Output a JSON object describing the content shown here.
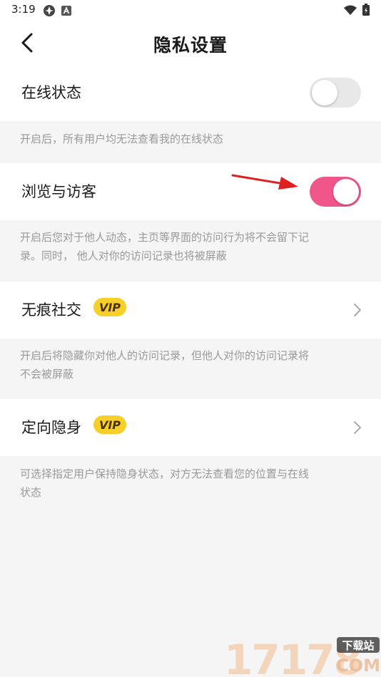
{
  "status_bar": {
    "time": "3:19"
  },
  "header": {
    "title": "隐私设置"
  },
  "settings": {
    "online_status": {
      "label": "在线状态",
      "enabled": false,
      "description": "开启后，所有用户均无法查看我的在线状态"
    },
    "browse_visitors": {
      "label": "浏览与访客",
      "enabled": true,
      "description_line1": "开启后您对于他人动态，主页等界面的访问行为将不会留下记",
      "description_line2": "录。同时， 他人对你的访问记录也将被屏蔽"
    },
    "traceless_social": {
      "label": "无痕社交",
      "badge": "VIP",
      "description_line1": "开启后将隐藏你对他人的访问记录，但他人对你的访问记录将",
      "description_line2": "不会被屏蔽"
    },
    "targeted_invisible": {
      "label": "定向隐身",
      "badge": "VIP",
      "description_line1": "可选择指定用户保持隐身状态，对方无法查看您的位置与在线",
      "description_line2": "状态"
    }
  },
  "watermark": {
    "number": "17178",
    "tag": "下载站",
    "domain": "COM"
  },
  "colors": {
    "toggle_on": "#f0568a",
    "toggle_off": "#e8e8e8",
    "vip_badge": "#f7cf2a",
    "annotation_arrow": "#e02020"
  }
}
